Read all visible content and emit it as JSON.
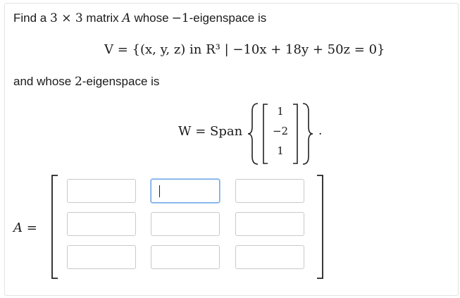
{
  "problem": {
    "intro_pre": "Find a",
    "intro_dim": "3 × 3",
    "intro_mid": "matrix",
    "matrix_symbol": "A",
    "intro_post": "whose",
    "eigenvalue_1": "−1",
    "intro_end": "-eigenspace is",
    "set_V": "V = {(x, y, z) in R³ | −10x + 18y + 50z = 0}",
    "and_text": "and whose",
    "eigenvalue_2": "2",
    "and_end": "-eigenspace is",
    "w_label": "W = Span",
    "w_vector": [
      "1",
      "−2",
      "1"
    ],
    "period": ".",
    "matrix_label": "A ="
  },
  "matrix_inputs": [
    [
      "",
      "",
      ""
    ],
    [
      "",
      "",
      ""
    ],
    [
      "",
      "",
      ""
    ]
  ],
  "focused_cell": "row-0-col-1"
}
